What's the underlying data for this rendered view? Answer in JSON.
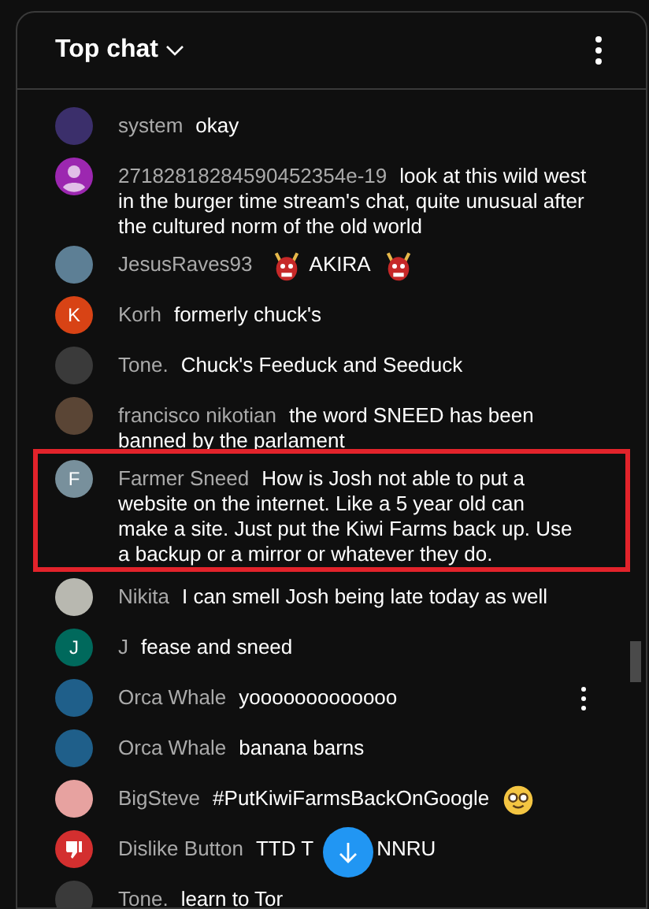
{
  "header": {
    "title": "Top chat"
  },
  "messages": [
    {
      "author": "system",
      "avatar": {
        "kind": "photo",
        "color": "#3b2f6b"
      },
      "parts": [
        {
          "kind": "text",
          "text": "okay"
        }
      ]
    },
    {
      "author": "27182818284590452354e-19",
      "avatar": {
        "kind": "person",
        "color": "#9c27b0"
      },
      "parts": [
        {
          "kind": "text",
          "text": "look at this wild west in the burger time stream's chat, quite unusual after the cultured norm of the old world"
        }
      ]
    },
    {
      "author": "JesusRaves93",
      "avatar": {
        "kind": "photo",
        "color": "#5d7f95"
      },
      "parts": [
        {
          "kind": "ogre"
        },
        {
          "kind": "text",
          "text": "AKIRA"
        },
        {
          "kind": "ogre"
        }
      ]
    },
    {
      "author": "Korh",
      "avatar": {
        "kind": "letter",
        "letter": "K",
        "color": "#d84315"
      },
      "parts": [
        {
          "kind": "text",
          "text": "formerly chuck's"
        }
      ]
    },
    {
      "author": "Tone.",
      "avatar": {
        "kind": "photo",
        "color": "#3a3a3a"
      },
      "parts": [
        {
          "kind": "text",
          "text": "Chuck's Feeduck and Seeduck"
        }
      ]
    },
    {
      "author": "francisco nikotian",
      "avatar": {
        "kind": "photo",
        "color": "#5a4535"
      },
      "parts": [
        {
          "kind": "text",
          "text": "the word SNEED has been banned by the parlament"
        }
      ]
    },
    {
      "author": "Farmer Sneed",
      "avatar": {
        "kind": "letter",
        "letter": "F",
        "color": "#78909c"
      },
      "highlighted": true,
      "parts": [
        {
          "kind": "text",
          "text": "How is Josh not able to put a website on the internet. Like a 5 year old can make a site. Just put the Kiwi Farms back up. Use a backup or a mirror or whatever they do."
        }
      ]
    },
    {
      "author": "Nikita",
      "avatar": {
        "kind": "photo",
        "color": "#b8b8b0"
      },
      "parts": [
        {
          "kind": "text",
          "text": "I can smell Josh being late today as well"
        }
      ]
    },
    {
      "author": "J",
      "avatar": {
        "kind": "letter",
        "letter": "J",
        "color": "#00695c"
      },
      "parts": [
        {
          "kind": "text",
          "text": "fease and sneed"
        }
      ]
    },
    {
      "author": "Orca Whale",
      "avatar": {
        "kind": "photo",
        "color": "#1f5f8a"
      },
      "menu_visible": true,
      "parts": [
        {
          "kind": "text",
          "text": "yooooooooooooo"
        }
      ]
    },
    {
      "author": "Orca Whale",
      "avatar": {
        "kind": "photo",
        "color": "#1f5f8a"
      },
      "parts": [
        {
          "kind": "text",
          "text": "banana barns"
        }
      ]
    },
    {
      "author": "BigSteve",
      "avatar": {
        "kind": "photo",
        "color": "#e7a2a0"
      },
      "parts": [
        {
          "kind": "text",
          "text": "#PutKiwiFarmsBackOnGoogle"
        },
        {
          "kind": "nerd"
        }
      ]
    },
    {
      "author": "Dislike Button",
      "avatar": {
        "kind": "thumb",
        "color": "#d32f2f"
      },
      "parts": [
        {
          "kind": "text",
          "text": "TTD T"
        },
        {
          "kind": "gap"
        },
        {
          "kind": "text",
          "text": "NNRU"
        }
      ]
    },
    {
      "author": "Tone.",
      "avatar": {
        "kind": "photo",
        "color": "#3a3a3a"
      },
      "parts": [
        {
          "kind": "text",
          "text": "learn to Tor"
        }
      ]
    }
  ]
}
